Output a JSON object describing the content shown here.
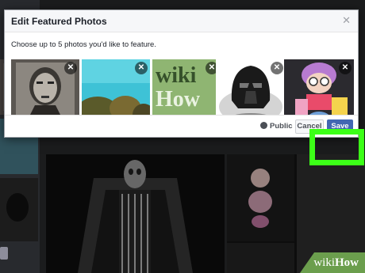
{
  "dialog": {
    "title": "Edit Featured Photos",
    "close_icon": "close-icon",
    "instructions": "Choose up to 5 photos you'd like to feature.",
    "photos": [
      {
        "name": "sketch-portrait-photo",
        "remove_label": "✕"
      },
      {
        "name": "coral-reef-photo",
        "remove_label": "✕"
      },
      {
        "name": "wikihow-logo-photo",
        "remove_label": "✕",
        "logo_text_line1": "wiki",
        "logo_text_line2": "How"
      },
      {
        "name": "darth-vader-photo",
        "remove_label": "✕"
      },
      {
        "name": "anime-figure-photo",
        "remove_label": "✕"
      }
    ],
    "footer": {
      "privacy_label": "Public",
      "cancel_label": "Cancel",
      "save_label": "Save"
    }
  },
  "colors": {
    "save_button": "#4267b2",
    "highlight": "#3cff17",
    "watermark": "#6b9e4d"
  },
  "watermark": {
    "part1": "wiki",
    "part2": "How"
  }
}
